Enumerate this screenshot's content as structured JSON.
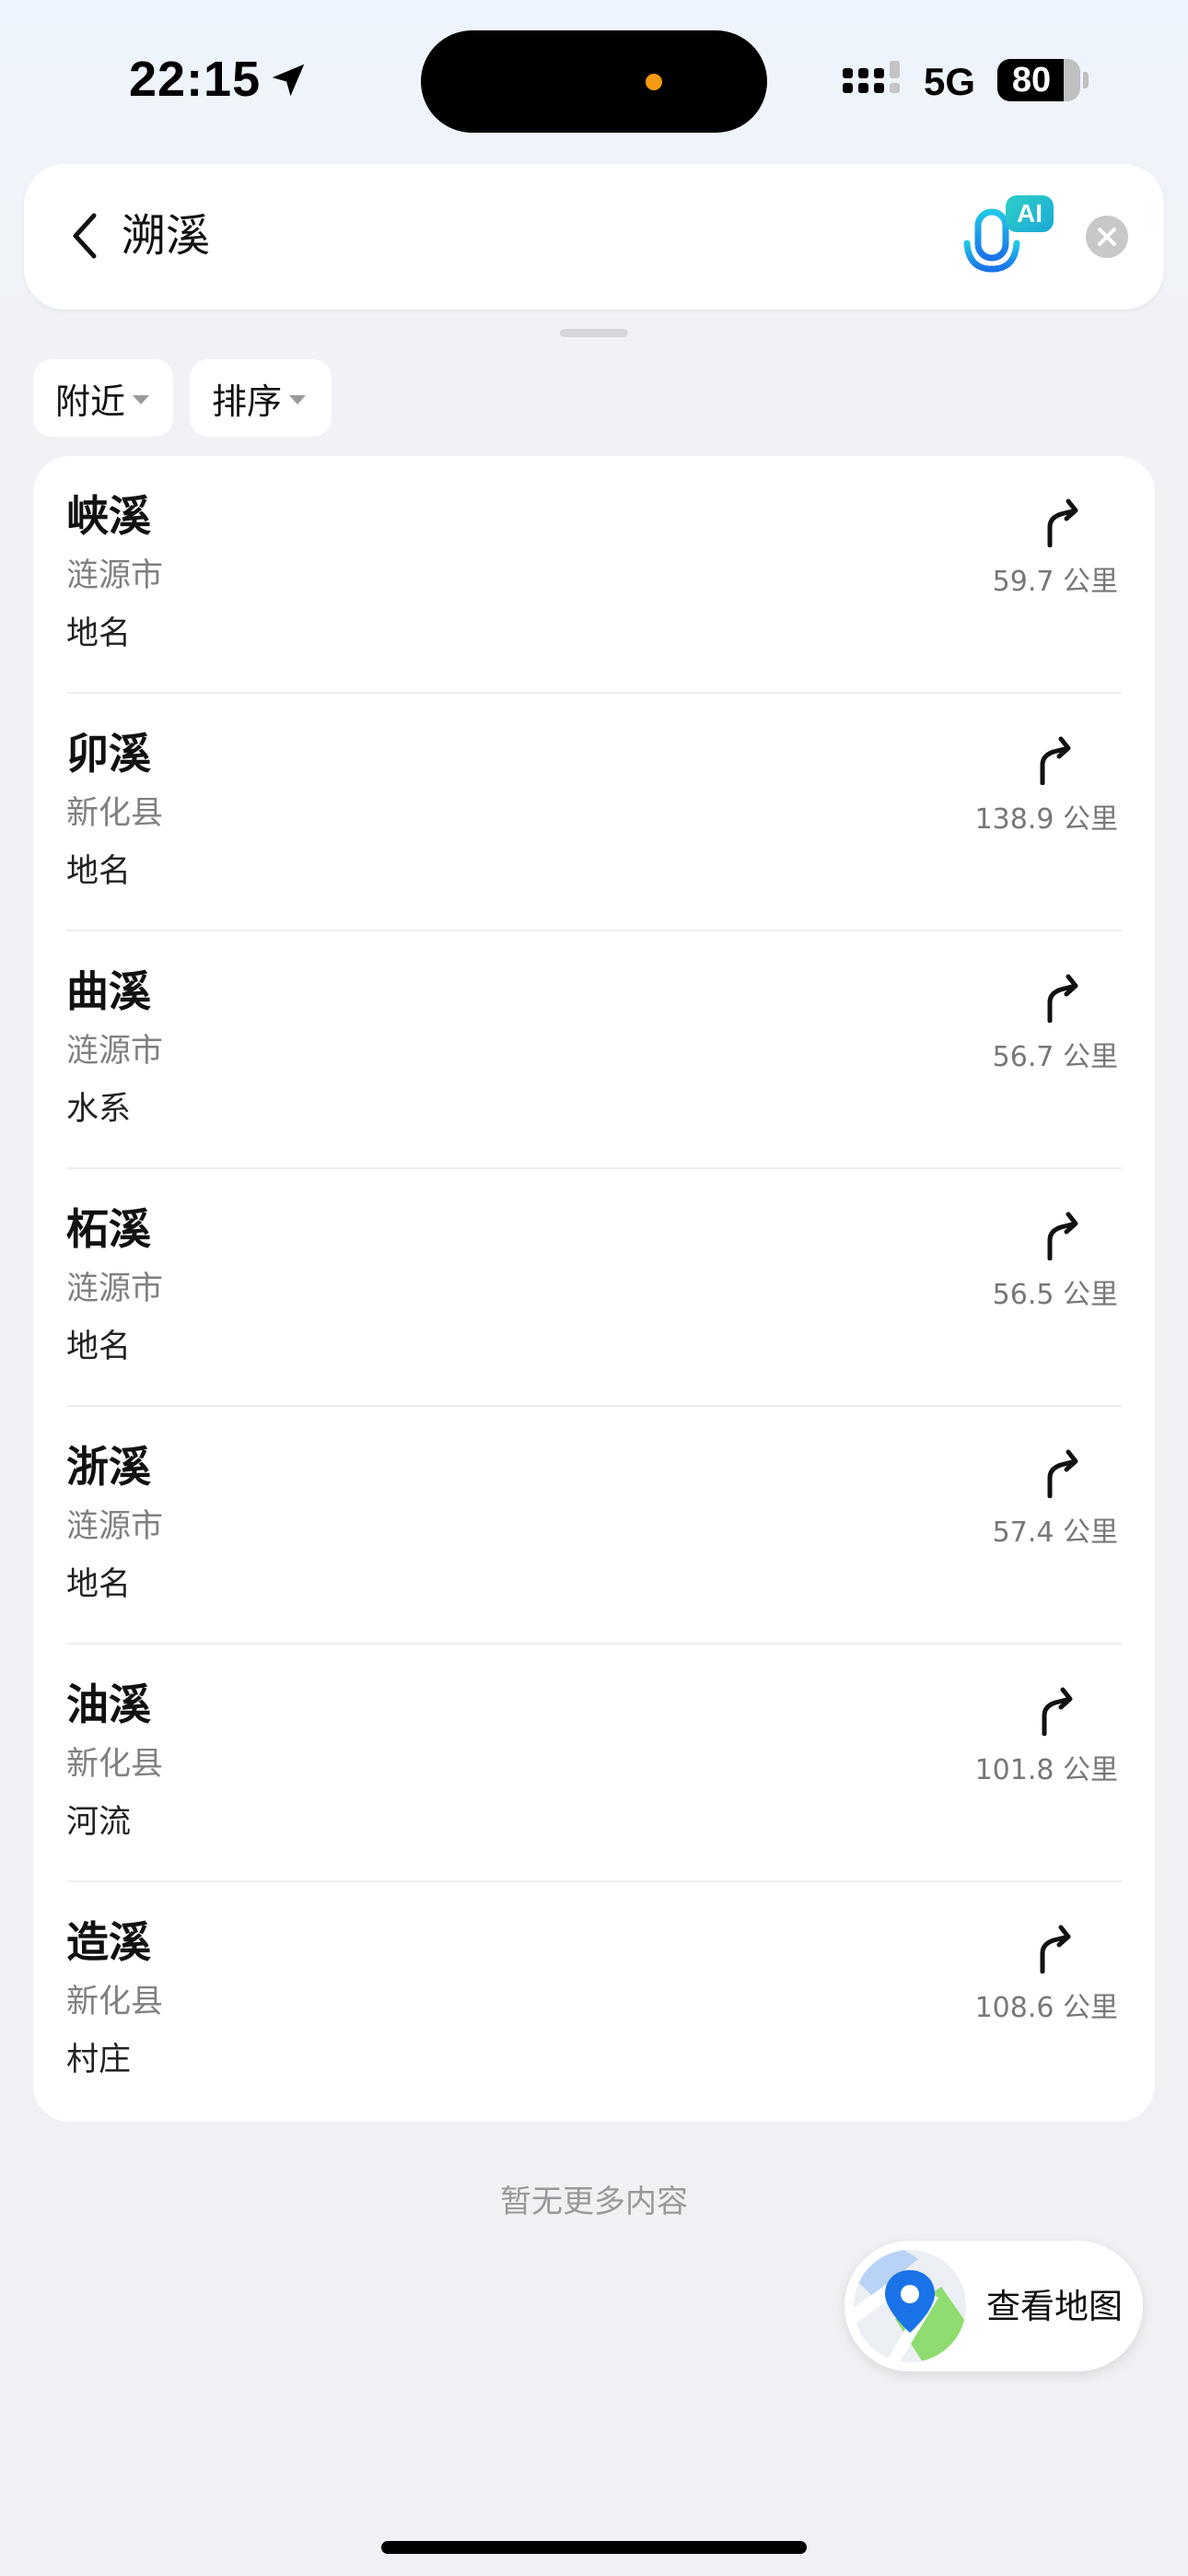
{
  "status_bar": {
    "time": "22:15",
    "network": "5G",
    "battery_level": "80",
    "battery_fraction": 0.8
  },
  "search": {
    "query": "溯溪",
    "ai_badge": "AI"
  },
  "filters": [
    {
      "label": "附近"
    },
    {
      "label": "排序"
    }
  ],
  "results": [
    {
      "name": "峡溪",
      "region": "涟源市",
      "type": "地名",
      "distance": "59.7 公里"
    },
    {
      "name": "卯溪",
      "region": "新化县",
      "type": "地名",
      "distance": "138.9 公里"
    },
    {
      "name": "曲溪",
      "region": "涟源市",
      "type": "水系",
      "distance": "56.7 公里"
    },
    {
      "name": "柘溪",
      "region": "涟源市",
      "type": "地名",
      "distance": "56.5 公里"
    },
    {
      "name": "浙溪",
      "region": "涟源市",
      "type": "地名",
      "distance": "57.4 公里"
    },
    {
      "name": "油溪",
      "region": "新化县",
      "type": "河流",
      "distance": "101.8 公里"
    },
    {
      "name": "造溪",
      "region": "新化县",
      "type": "村庄",
      "distance": "108.6 公里"
    }
  ],
  "footer": {
    "no_more_text": "暂无更多内容",
    "view_map_label": "查看地图"
  },
  "icons": {
    "back": "chevron-left-icon",
    "voice": "ai-microphone-icon",
    "clear": "clear-circle-icon",
    "navigate": "route-turn-arrow-icon",
    "map": "map-pin-icon"
  },
  "colors": {
    "accent_blue": "#1a73e8",
    "ai_badge": "#1fc2c9",
    "map_green": "#8fdc70",
    "status_dot": "#f59a12"
  }
}
